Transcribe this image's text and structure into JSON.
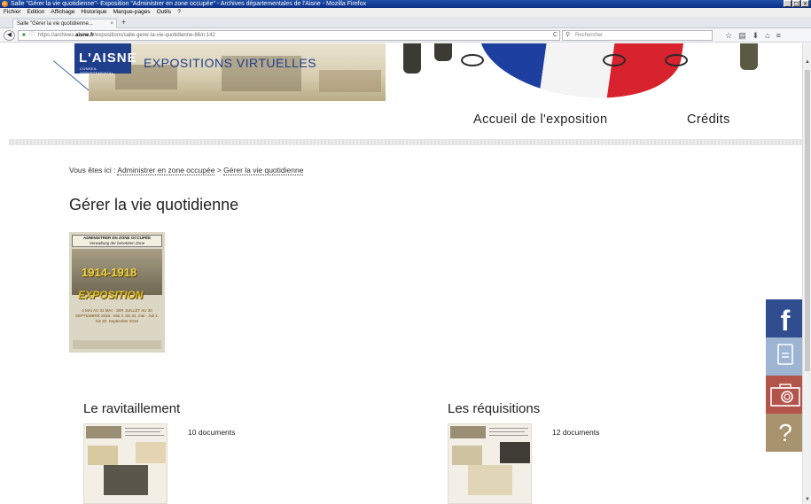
{
  "window": {
    "title": "Salle \"Gérer la vie quotidienne\"- Exposition \"Administrer en zone occupée\" - Archives départementales de l'Aisne - Mozilla Firefox",
    "controls": [
      "_",
      "□",
      "×"
    ]
  },
  "menu": {
    "items": [
      "Fichier",
      "Edition",
      "Affichage",
      "Historique",
      "Marque-pages",
      "Outils",
      "?"
    ]
  },
  "tabs": [
    {
      "label": "Salle \"Gérer la vie quotidienne...",
      "close": "×"
    }
  ],
  "new_tab": "+",
  "navigation": {
    "url_prefix": "https://archives.",
    "url_domain": "aisne.fr",
    "url_path": "/expositions/salle-gerer-la-vie-quotidienne-86/n:142",
    "search_placeholder": "Rechercher"
  },
  "header": {
    "logo_text": "L'AISNE",
    "logo_subtext": "CONSEIL DÉPARTEMENTAL",
    "expo_title": "EXPOSITIONS VIRTUELLES"
  },
  "topnav": {
    "home": "Accueil de l'exposition",
    "credits": "Crédits"
  },
  "breadcrumb": {
    "prefix": "Vous êtes ici :",
    "crumb1": "Administrer en zone occupée",
    "separator": ">",
    "crumb2": "Gérer la vie quotidienne"
  },
  "main": {
    "page_title": "Gérer la vie quotidienne",
    "poster": {
      "header_line1": "ADMINISTRER EN ZONE OCCUPÉE",
      "header_line2": "Verwaltung der besetzten Zone",
      "years": "1914-1918",
      "expo_word": "EXPOSITION",
      "dates": "4 MAI AU 31 MAI · 1ER JUILLET AU 30 SEPTEMBRE 2018 · Mai 4. bis 31. mai · Juli 1. bis 30. September 2018"
    },
    "sections": [
      {
        "title": "Le ravitaillement",
        "count": "10 documents"
      },
      {
        "title": "Les réquisitions",
        "count": "12 documents"
      }
    ]
  },
  "side_buttons": {
    "facebook": "f",
    "help": "?"
  },
  "colors": {
    "brand_blue": "#1f3f8c",
    "facebook": "#2f4d8f",
    "doc": "#9db5d3",
    "camera": "#b3544a",
    "help": "#a7936d"
  }
}
